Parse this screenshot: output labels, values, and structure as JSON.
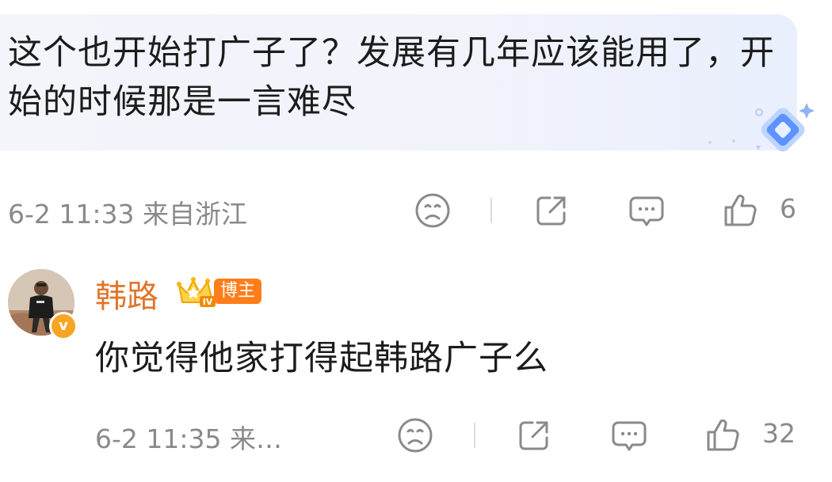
{
  "comment": {
    "text": "这个也开始打广子了？发展有几年应该能用了，开始的时候那是一言难尽",
    "meta": "6-2 11:33 来自浙江",
    "like_count": "6"
  },
  "reply": {
    "username": "韩路",
    "badge_level": "IV",
    "role_tag": "博主",
    "verified_mark": "v",
    "text": "你觉得他家打得起韩路广子么",
    "meta": "6-2 11:35 来…",
    "like_count": "32"
  },
  "colors": {
    "username": "#e0762a",
    "meta_text": "#8a8a8a",
    "blogger_tag": "#ff7d1a",
    "bubble_bg": "#f2f4fb"
  },
  "icons": [
    "frown-icon",
    "share-icon",
    "comment-icon",
    "like-icon",
    "diamond-icon",
    "crown-icon"
  ]
}
